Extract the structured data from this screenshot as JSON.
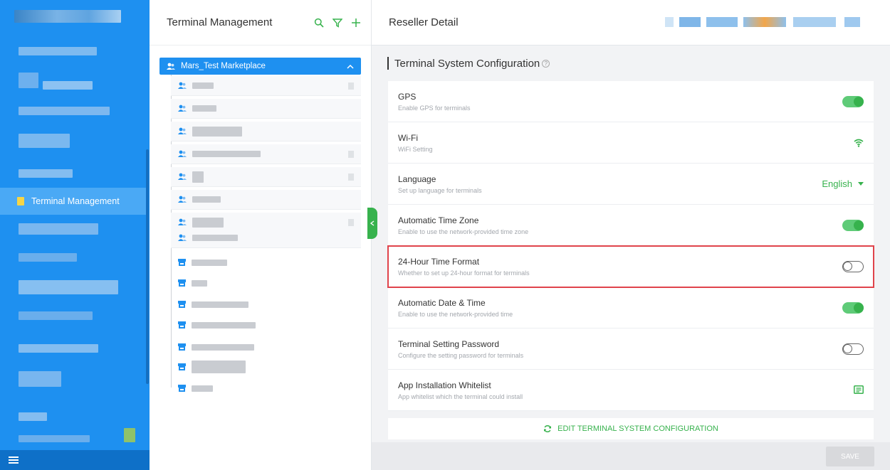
{
  "sidebar": {
    "active_item": "Terminal Management",
    "menu_icon": "hamburger-icon"
  },
  "tree_panel": {
    "title": "Terminal Management",
    "actions": [
      "search-icon",
      "filter-icon",
      "add-icon"
    ],
    "root_label": "Mars_Test Marketplace"
  },
  "detail": {
    "title": "Reseller Detail",
    "section_title": "Terminal System Configuration",
    "items": [
      {
        "name": "GPS",
        "desc": "Enable GPS for terminals",
        "control": "toggle",
        "state": "on"
      },
      {
        "name": "Wi-Fi",
        "desc": "WiFi Setting",
        "control": "icon",
        "icon": "wifi-icon"
      },
      {
        "name": "Language",
        "desc": "Set up language for terminals",
        "control": "select",
        "value": "English"
      },
      {
        "name": "Automatic Time Zone",
        "desc": "Enable to use the network-provided time zone",
        "control": "toggle",
        "state": "on"
      },
      {
        "name": "24-Hour Time Format",
        "desc": "Whether to set up 24-hour format for terminals",
        "control": "toggle",
        "state": "off"
      },
      {
        "name": "Automatic Date & Time",
        "desc": "Enable to use the network-provided time",
        "control": "toggle",
        "state": "on"
      },
      {
        "name": "Terminal Setting Password",
        "desc": "Configure the setting password for terminals",
        "control": "toggle",
        "state": "off"
      },
      {
        "name": "App Installation Whitelist",
        "desc": "App whitelist which the terminal could install",
        "control": "icon",
        "icon": "list-icon"
      }
    ],
    "edit_label": "EDIT TERMINAL SYSTEM CONFIGURATION",
    "save_label": "SAVE"
  },
  "colors": {
    "sidebar": "#1e90f0",
    "accent_green": "#37b24d",
    "highlight_red": "#e0434b"
  }
}
